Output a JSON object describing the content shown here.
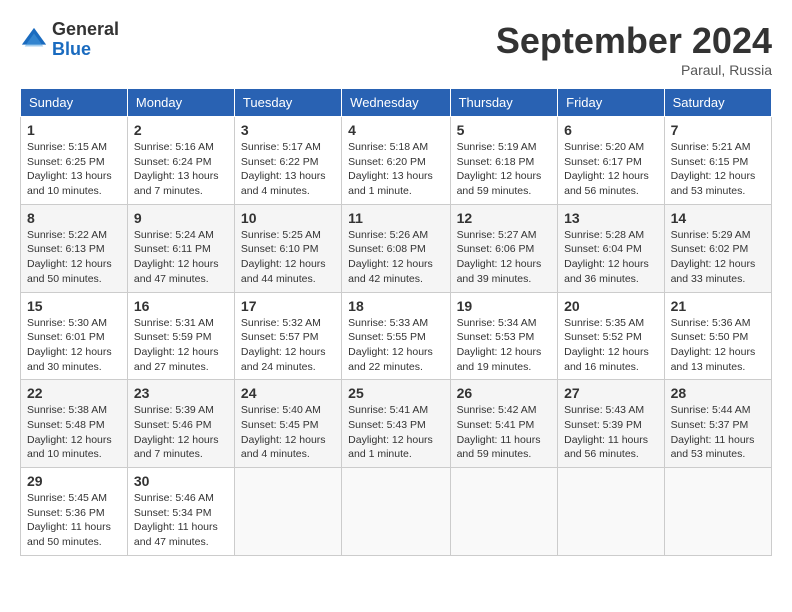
{
  "logo": {
    "general": "General",
    "blue": "Blue"
  },
  "title": "September 2024",
  "location": "Paraul, Russia",
  "days_of_week": [
    "Sunday",
    "Monday",
    "Tuesday",
    "Wednesday",
    "Thursday",
    "Friday",
    "Saturday"
  ],
  "weeks": [
    [
      {
        "day": "1",
        "sunrise": "Sunrise: 5:15 AM",
        "sunset": "Sunset: 6:25 PM",
        "daylight": "Daylight: 13 hours and 10 minutes."
      },
      {
        "day": "2",
        "sunrise": "Sunrise: 5:16 AM",
        "sunset": "Sunset: 6:24 PM",
        "daylight": "Daylight: 13 hours and 7 minutes."
      },
      {
        "day": "3",
        "sunrise": "Sunrise: 5:17 AM",
        "sunset": "Sunset: 6:22 PM",
        "daylight": "Daylight: 13 hours and 4 minutes."
      },
      {
        "day": "4",
        "sunrise": "Sunrise: 5:18 AM",
        "sunset": "Sunset: 6:20 PM",
        "daylight": "Daylight: 13 hours and 1 minute."
      },
      {
        "day": "5",
        "sunrise": "Sunrise: 5:19 AM",
        "sunset": "Sunset: 6:18 PM",
        "daylight": "Daylight: 12 hours and 59 minutes."
      },
      {
        "day": "6",
        "sunrise": "Sunrise: 5:20 AM",
        "sunset": "Sunset: 6:17 PM",
        "daylight": "Daylight: 12 hours and 56 minutes."
      },
      {
        "day": "7",
        "sunrise": "Sunrise: 5:21 AM",
        "sunset": "Sunset: 6:15 PM",
        "daylight": "Daylight: 12 hours and 53 minutes."
      }
    ],
    [
      {
        "day": "8",
        "sunrise": "Sunrise: 5:22 AM",
        "sunset": "Sunset: 6:13 PM",
        "daylight": "Daylight: 12 hours and 50 minutes."
      },
      {
        "day": "9",
        "sunrise": "Sunrise: 5:24 AM",
        "sunset": "Sunset: 6:11 PM",
        "daylight": "Daylight: 12 hours and 47 minutes."
      },
      {
        "day": "10",
        "sunrise": "Sunrise: 5:25 AM",
        "sunset": "Sunset: 6:10 PM",
        "daylight": "Daylight: 12 hours and 44 minutes."
      },
      {
        "day": "11",
        "sunrise": "Sunrise: 5:26 AM",
        "sunset": "Sunset: 6:08 PM",
        "daylight": "Daylight: 12 hours and 42 minutes."
      },
      {
        "day": "12",
        "sunrise": "Sunrise: 5:27 AM",
        "sunset": "Sunset: 6:06 PM",
        "daylight": "Daylight: 12 hours and 39 minutes."
      },
      {
        "day": "13",
        "sunrise": "Sunrise: 5:28 AM",
        "sunset": "Sunset: 6:04 PM",
        "daylight": "Daylight: 12 hours and 36 minutes."
      },
      {
        "day": "14",
        "sunrise": "Sunrise: 5:29 AM",
        "sunset": "Sunset: 6:02 PM",
        "daylight": "Daylight: 12 hours and 33 minutes."
      }
    ],
    [
      {
        "day": "15",
        "sunrise": "Sunrise: 5:30 AM",
        "sunset": "Sunset: 6:01 PM",
        "daylight": "Daylight: 12 hours and 30 minutes."
      },
      {
        "day": "16",
        "sunrise": "Sunrise: 5:31 AM",
        "sunset": "Sunset: 5:59 PM",
        "daylight": "Daylight: 12 hours and 27 minutes."
      },
      {
        "day": "17",
        "sunrise": "Sunrise: 5:32 AM",
        "sunset": "Sunset: 5:57 PM",
        "daylight": "Daylight: 12 hours and 24 minutes."
      },
      {
        "day": "18",
        "sunrise": "Sunrise: 5:33 AM",
        "sunset": "Sunset: 5:55 PM",
        "daylight": "Daylight: 12 hours and 22 minutes."
      },
      {
        "day": "19",
        "sunrise": "Sunrise: 5:34 AM",
        "sunset": "Sunset: 5:53 PM",
        "daylight": "Daylight: 12 hours and 19 minutes."
      },
      {
        "day": "20",
        "sunrise": "Sunrise: 5:35 AM",
        "sunset": "Sunset: 5:52 PM",
        "daylight": "Daylight: 12 hours and 16 minutes."
      },
      {
        "day": "21",
        "sunrise": "Sunrise: 5:36 AM",
        "sunset": "Sunset: 5:50 PM",
        "daylight": "Daylight: 12 hours and 13 minutes."
      }
    ],
    [
      {
        "day": "22",
        "sunrise": "Sunrise: 5:38 AM",
        "sunset": "Sunset: 5:48 PM",
        "daylight": "Daylight: 12 hours and 10 minutes."
      },
      {
        "day": "23",
        "sunrise": "Sunrise: 5:39 AM",
        "sunset": "Sunset: 5:46 PM",
        "daylight": "Daylight: 12 hours and 7 minutes."
      },
      {
        "day": "24",
        "sunrise": "Sunrise: 5:40 AM",
        "sunset": "Sunset: 5:45 PM",
        "daylight": "Daylight: 12 hours and 4 minutes."
      },
      {
        "day": "25",
        "sunrise": "Sunrise: 5:41 AM",
        "sunset": "Sunset: 5:43 PM",
        "daylight": "Daylight: 12 hours and 1 minute."
      },
      {
        "day": "26",
        "sunrise": "Sunrise: 5:42 AM",
        "sunset": "Sunset: 5:41 PM",
        "daylight": "Daylight: 11 hours and 59 minutes."
      },
      {
        "day": "27",
        "sunrise": "Sunrise: 5:43 AM",
        "sunset": "Sunset: 5:39 PM",
        "daylight": "Daylight: 11 hours and 56 minutes."
      },
      {
        "day": "28",
        "sunrise": "Sunrise: 5:44 AM",
        "sunset": "Sunset: 5:37 PM",
        "daylight": "Daylight: 11 hours and 53 minutes."
      }
    ],
    [
      {
        "day": "29",
        "sunrise": "Sunrise: 5:45 AM",
        "sunset": "Sunset: 5:36 PM",
        "daylight": "Daylight: 11 hours and 50 minutes."
      },
      {
        "day": "30",
        "sunrise": "Sunrise: 5:46 AM",
        "sunset": "Sunset: 5:34 PM",
        "daylight": "Daylight: 11 hours and 47 minutes."
      },
      null,
      null,
      null,
      null,
      null
    ]
  ]
}
